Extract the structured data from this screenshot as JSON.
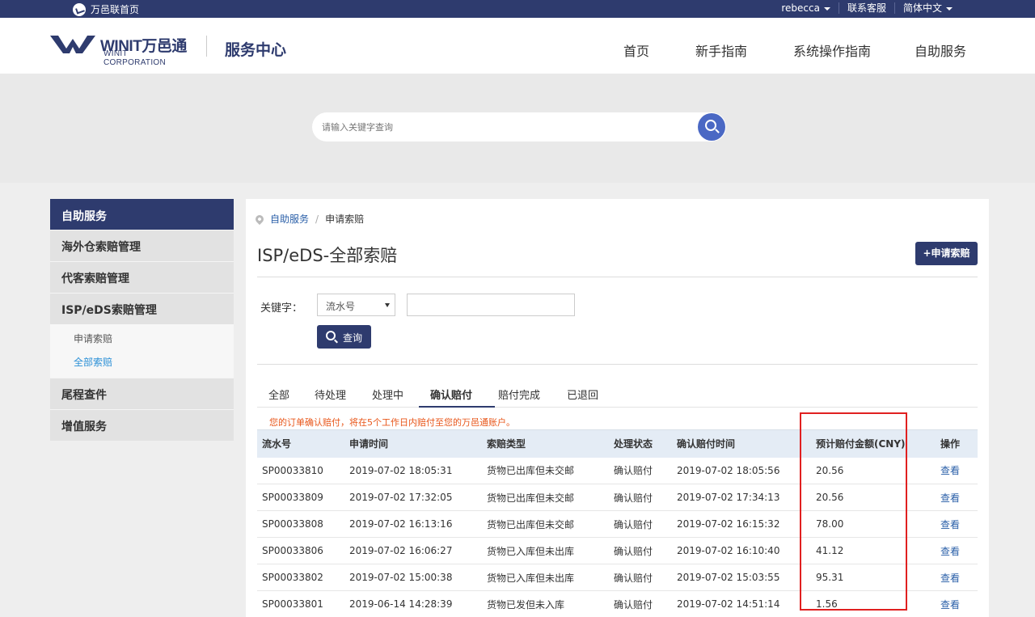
{
  "topbar": {
    "home": "万邑联首页",
    "user": "rebecca",
    "service": "联系客服",
    "lang": "简体中文"
  },
  "header": {
    "brand_main": "WINIT万邑通",
    "brand_sub": "WINIT CORPORATION",
    "service_center": "服务中心",
    "nav": [
      "首页",
      "新手指南",
      "系统操作指南",
      "自助服务"
    ]
  },
  "search": {
    "placeholder": "请输入关键字查询"
  },
  "sidebar": {
    "head": "自助服务",
    "items": [
      "海外仓索赔管理",
      "代客索赔管理",
      "ISP/eDS索赔管理"
    ],
    "sub_items": [
      "申请索赔",
      "全部索赔"
    ],
    "items_after": [
      "尾程查件",
      "增值服务"
    ]
  },
  "main": {
    "breadcrumb": {
      "root": "自助服务",
      "current": "申请索赔"
    },
    "title": "ISP/eDS-全部索赔",
    "add_button": "+申请索赔",
    "keyword_label": "关键字：",
    "select_value": "流水号",
    "query_button": "查询",
    "tabs": [
      "全部",
      "待处理",
      "处理中",
      "确认赔付",
      "赔付完成",
      "已退回"
    ],
    "active_tab": "确认赔付",
    "notice": "您的订单确认赔付，将在5个工作日内赔付至您的万邑通账户。"
  },
  "table": {
    "headers": [
      "流水号",
      "申请时间",
      "索赔类型",
      "处理状态",
      "确认赔付时间",
      "预计赔付金额(CNY)",
      "操作"
    ],
    "rows": [
      [
        "SP00033810",
        "2019-07-02 18:05:31",
        "货物已出库但未交邮",
        "确认赔付",
        "2019-07-02 18:05:56",
        "20.56",
        "查看"
      ],
      [
        "SP00033809",
        "2019-07-02 17:32:05",
        "货物已出库但未交邮",
        "确认赔付",
        "2019-07-02 17:34:13",
        "20.56",
        "查看"
      ],
      [
        "SP00033808",
        "2019-07-02 16:13:16",
        "货物已出库但未交邮",
        "确认赔付",
        "2019-07-02 16:15:32",
        "78.00",
        "查看"
      ],
      [
        "SP00033806",
        "2019-07-02 16:06:27",
        "货物已入库但未出库",
        "确认赔付",
        "2019-07-02 16:10:40",
        "41.12",
        "查看"
      ],
      [
        "SP00033802",
        "2019-07-02 15:00:38",
        "货物已入库但未出库",
        "确认赔付",
        "2019-07-02 15:03:55",
        "95.31",
        "查看"
      ],
      [
        "SP00033801",
        "2019-06-14 14:28:39",
        "货物已发但未入库",
        "确认赔付",
        "2019-07-02 14:51:14",
        "1.56",
        "查看"
      ]
    ]
  },
  "colors": {
    "navy": "#2e3b6e",
    "accent_blue": "#4a68c4",
    "notice": "#e8561a",
    "highlight": "#e02020"
  }
}
